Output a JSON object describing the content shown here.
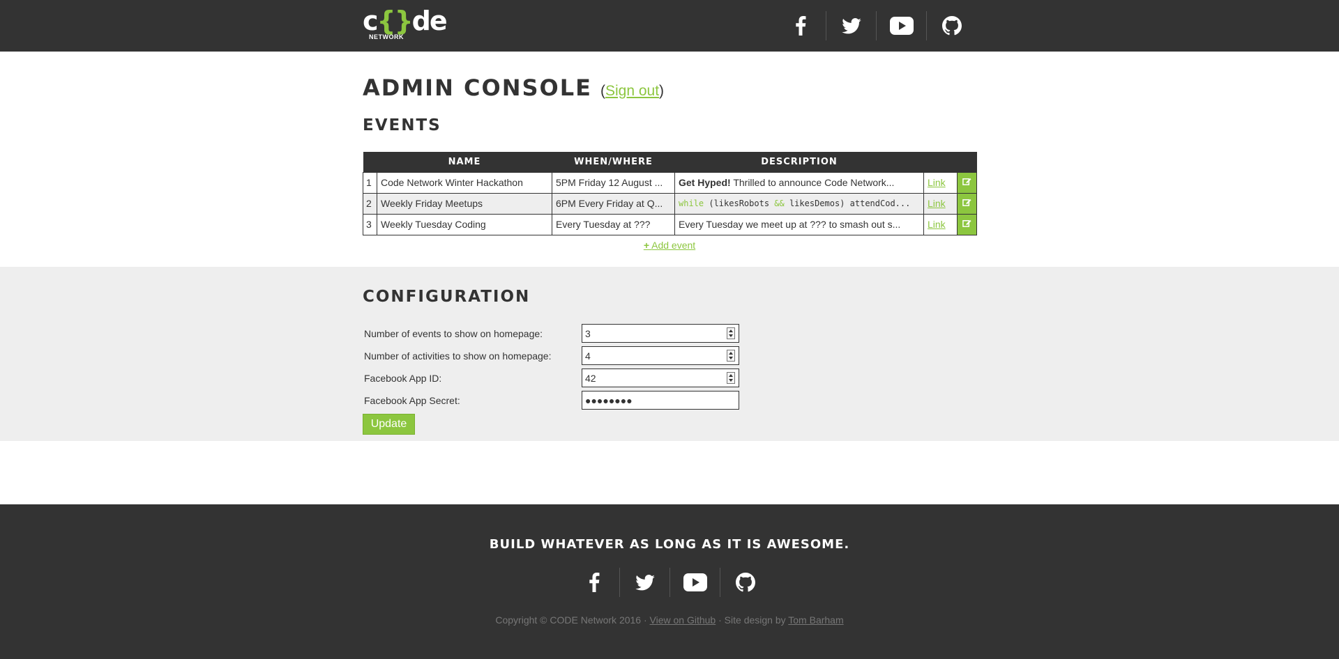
{
  "header": {
    "logo": {
      "word": "c{}de",
      "sub": "NETWORK"
    },
    "social": [
      {
        "icon": "facebook-icon",
        "label": "Facebook"
      },
      {
        "icon": "twitter-icon",
        "label": "Twitter"
      },
      {
        "icon": "youtube-icon",
        "label": "YouTube"
      },
      {
        "icon": "github-icon",
        "label": "GitHub"
      }
    ]
  },
  "main": {
    "title": "ADMIN CONSOLE",
    "signout_label": "Sign out",
    "events_title": "EVENTS",
    "events_table": {
      "headers": [
        "NAME",
        "WHEN/WHERE",
        "DESCRIPTION"
      ],
      "rows": [
        {
          "num": "1",
          "name": "Code Network Winter Hackathon",
          "when": "5PM Friday 12 August ...",
          "desc_bold": "Get Hyped!",
          "desc_rest": " Thrilled to announce Code Network...",
          "link": "Link"
        },
        {
          "num": "2",
          "name": "Weekly Friday Meetups",
          "when": "6PM Every Friday at Q...",
          "desc_kw1": "while",
          "desc_code1": " (likesRobots ",
          "desc_kw2": "&&",
          "desc_code2": " likesDemos) attendCod...",
          "link": "Link"
        },
        {
          "num": "3",
          "name": "Weekly Tuesday Coding",
          "when": "Every Tuesday at ???",
          "desc": "Every Tuesday we meet up at ??? to smash out s...",
          "link": "Link"
        }
      ]
    },
    "add_event_label": "Add event"
  },
  "config": {
    "title": "CONFIGURATION",
    "fields": [
      {
        "label": "Number of events to show on homepage:",
        "value": "3"
      },
      {
        "label": "Number of activities to show on homepage:",
        "value": "4"
      },
      {
        "label": "Facebook App ID:",
        "value": "42"
      },
      {
        "label": "Facebook App Secret:",
        "value": "●●●●●●●●"
      }
    ],
    "update_label": "Update"
  },
  "footer": {
    "slogan": "BUILD WHATEVER AS LONG AS IT IS AWESOME.",
    "copyright_prefix": "Copyright © CODE Network 2016 · ",
    "github_link": "View on Github",
    "middle": " · Site design by ",
    "designer_link": "Tom Barham"
  },
  "colors": {
    "accent": "#8cc63f",
    "dark": "#333333",
    "light_bg": "#eeeeee"
  }
}
